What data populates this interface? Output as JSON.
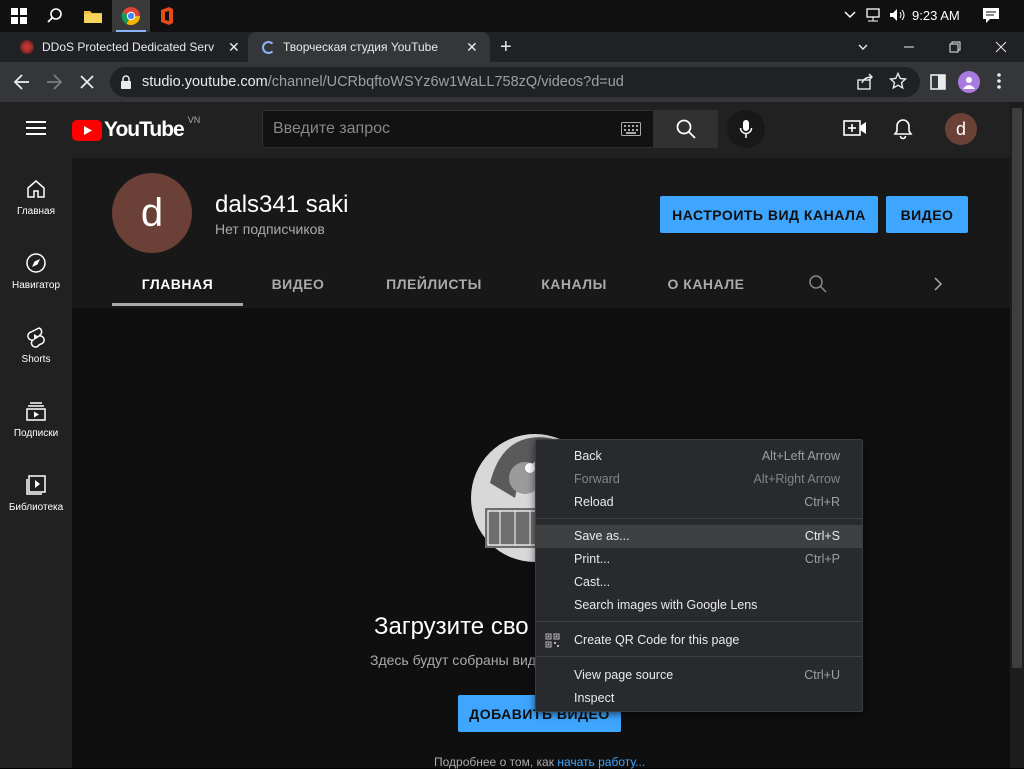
{
  "taskbar": {
    "time": "9:23 AM"
  },
  "tabs": [
    {
      "title": "DDoS Protected Dedicated Serve"
    },
    {
      "title": "Творческая студия YouTube"
    }
  ],
  "address": {
    "host": "studio.youtube.com",
    "path": "/channel/UCRbqftoWSYz6w1WaLL758zQ/videos?d=ud"
  },
  "youtube": {
    "logo_text": "YouTube",
    "region": "VN",
    "search_placeholder": "Введите запрос",
    "avatar_letter": "d",
    "guide": [
      "Главная",
      "Навигатор",
      "Shorts",
      "Подписки",
      "Библиотека"
    ],
    "channel": {
      "avatar_letter": "d",
      "name": "dals341 saki",
      "subscribers": "Нет подписчиков",
      "customize_button": "НАСТРОИТЬ ВИД КАНАЛА",
      "video_button": "ВИДЕО",
      "tabs": [
        "ГЛАВНАЯ",
        "ВИДЕО",
        "ПЛЕЙЛИСТЫ",
        "КАНАЛЫ",
        "О КАНАЛЕ"
      ]
    },
    "empty": {
      "title": "Загрузите сво",
      "subtitle": "Здесь будут собраны вид",
      "upload_button": "ДОБАВИТЬ ВИДЕО",
      "footer": "Подробнее о том, как",
      "footer_link": "начать работу..."
    }
  },
  "context_menu": {
    "items": [
      {
        "label": "Back",
        "shortcut": "Alt+Left Arrow"
      },
      {
        "label": "Forward",
        "shortcut": "Alt+Right Arrow"
      },
      {
        "label": "Reload",
        "shortcut": "Ctrl+R"
      },
      {
        "label": "Save as...",
        "shortcut": "Ctrl+S"
      },
      {
        "label": "Print...",
        "shortcut": "Ctrl+P"
      },
      {
        "label": "Cast...",
        "shortcut": ""
      },
      {
        "label": "Search images with Google Lens",
        "shortcut": ""
      },
      {
        "label": "Create QR Code for this page",
        "shortcut": ""
      },
      {
        "label": "View page source",
        "shortcut": "Ctrl+U"
      },
      {
        "label": "Inspect",
        "shortcut": ""
      }
    ]
  },
  "colors": {
    "accent_blue": "#3ea6ff",
    "youtube_red": "#ff0000"
  }
}
